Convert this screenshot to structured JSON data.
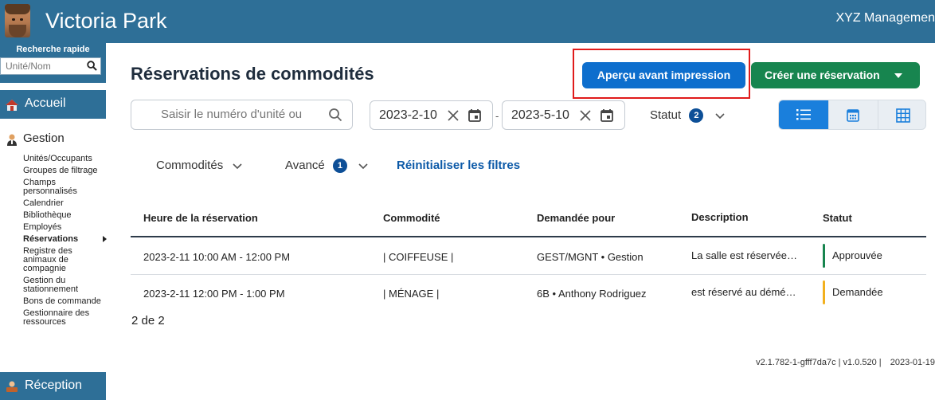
{
  "header": {
    "app_title": "Victoria Park",
    "company": "XYZ Managemen"
  },
  "sidebar": {
    "quick_search_title": "Recherche rapide",
    "quick_search_placeholder": "Unité/Nom",
    "accueil": "Accueil",
    "gestion": "Gestion",
    "items": [
      "Unités/Occupants",
      "Groupes de filtrage",
      "Champs personnalisés",
      "Calendrier",
      "Bibliothèque",
      "Employés",
      "Réservations",
      "Registre des animaux de compagnie",
      "Gestion du stationnement",
      "Bons de commande",
      "Gestionnaire des ressources"
    ],
    "active_item": "Réservations",
    "reception": "Réception"
  },
  "main": {
    "title": "Réservations de commodités",
    "preview_button": "Aperçu avant impression",
    "create_button": "Créer une réservation",
    "search_placeholder": "Saisir le numéro d'unité ou",
    "date_from": "2023-2-10",
    "date_separator": "-",
    "date_to": "2023-5-10",
    "status_filter": "Statut",
    "status_filter_count": "2",
    "commodites_filter": "Commodités",
    "advanced_filter": "Avancé",
    "advanced_filter_count": "1",
    "reset_filters": "Réinitialiser les filtres"
  },
  "table": {
    "columns": [
      "Heure de la réservation",
      "Commodité",
      "Demandée pour",
      "Description",
      "Statut"
    ],
    "rows": [
      {
        "time": "2023-2-11 10:00 AM - 12:00 PM",
        "amenity": "| COIFFEUSE |",
        "requested_for": "GEST/MGNT • Gestion",
        "description": "La salle est réservée…",
        "status": "Approuvée",
        "status_color": "#17854f"
      },
      {
        "time": "2023-2-11 12:00 PM - 1:00 PM",
        "amenity": "| MÉNAGE |",
        "requested_for": "6B • Anthony Rodriguez",
        "description": "est réservé au démé…",
        "status": "Demandée",
        "status_color": "#f2b01e"
      }
    ],
    "pager": "2 de 2"
  },
  "footer": {
    "version": "v2.1.782-1-gfff7da7c | v1.0.520 |",
    "date": "2023-01-19"
  },
  "colors": {
    "brand": "#2e6f97",
    "primary": "#0d6ecd",
    "success": "#17854f",
    "highlight": "#e01b1b"
  }
}
